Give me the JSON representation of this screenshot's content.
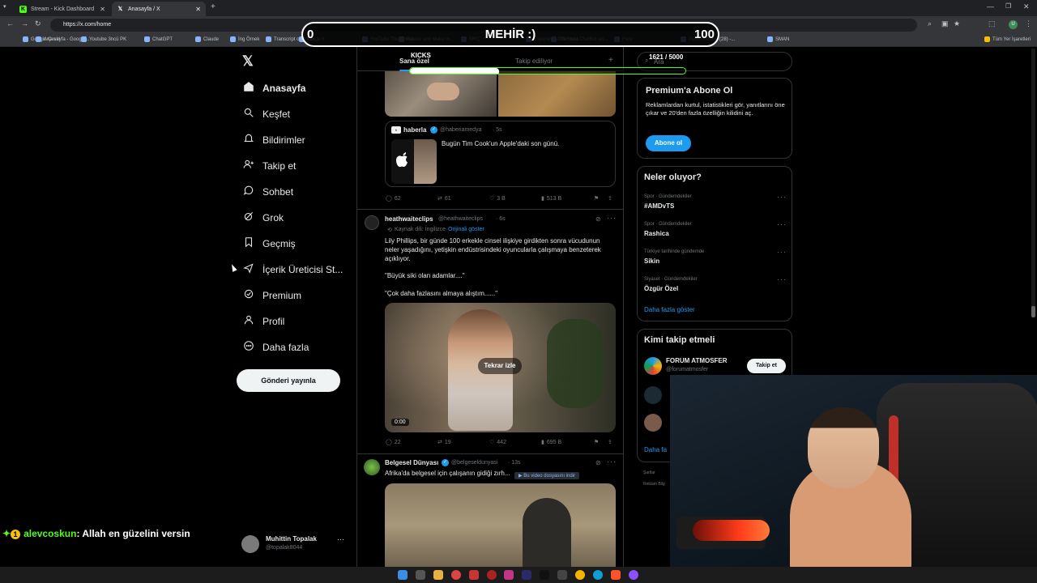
{
  "browser": {
    "tabs": [
      {
        "title": "Stream - Kick Dashboard",
        "active": false
      },
      {
        "title": "Anasayfa / X",
        "active": true
      }
    ],
    "url": "https://x.com/home",
    "bookmarks": [
      "Google Çeviri",
      "Ana sayfa - Google...",
      "Youtube 3ncü PK",
      "ChatGPT",
      "Claude",
      "İng Örnek",
      "Transcript of \"Mi M...",
      "türkçe h",
      "YouTube Thumbnail...",
      "Resize and Make In...",
      "MRÇ",
      "Esperanza000 Strea...",
      "The best ChatBot an...",
      "Flow",
      "Gelen Kutusu (28) -...",
      "SMAN"
    ],
    "bookmarks_right": "Tüm Yer İşaretleri"
  },
  "overlay": {
    "goal_title": "MEHİR :)",
    "goal_min": "0",
    "goal_max": "100",
    "kicks_label": "KICKS",
    "kicks_count": "1621 / 5000",
    "kicks_progress": 0.3242,
    "chat_user": "alevcoskun",
    "chat_msg": ": Allah en güzelini versin",
    "chat_badge": "1"
  },
  "sidebar": {
    "items": [
      {
        "label": "Anasayfa",
        "icon": "home-icon"
      },
      {
        "label": "Keşfet",
        "icon": "search-icon"
      },
      {
        "label": "Bildirimler",
        "icon": "bell-icon"
      },
      {
        "label": "Takip et",
        "icon": "follow-icon"
      },
      {
        "label": "Sohbet",
        "icon": "chat-icon"
      },
      {
        "label": "Grok",
        "icon": "grok-icon"
      },
      {
        "label": "Geçmiş",
        "icon": "bookmark-icon"
      },
      {
        "label": "İçerik Üreticisi St...",
        "icon": "creator-icon"
      },
      {
        "label": "Premium",
        "icon": "premium-icon"
      },
      {
        "label": "Profil",
        "icon": "profile-icon"
      },
      {
        "label": "Daha fazla",
        "icon": "more-icon"
      }
    ],
    "post_button": "Gönderi yayınla",
    "user_name": "Muhittin Topalak",
    "user_handle": "@topalak8044"
  },
  "feed": {
    "tabs": [
      "Sana özel",
      "Takip ediliyor"
    ],
    "quote": {
      "name": "haberla",
      "handle": "@haberiamedya",
      "time": "· 5s",
      "text": "Bugün Tim Cook'un Apple'daki son günü."
    },
    "tweet1_actions": {
      "replies": "62",
      "retweets": "61",
      "likes": "3 B",
      "views": "513 B"
    },
    "tweet2": {
      "name": "heathwaiteclips",
      "handle": "@heathwaiteclips",
      "time": "· 6s",
      "translation_note": "Kaynak dili: İngilizce",
      "translation_link": "Orijinali göster",
      "text": "Lily Phillips, bir günde 100 erkekle cinsel ilişkiye girdikten sonra vücudunun neler yaşadığını, yetişkin endüstrisindeki oyuncularla çalışmaya benzeterek açıklıyor.",
      "quote1": "\"Büyük siki olan adamlar....\"",
      "quote2": "\"Çok daha fazlasını almaya alıştım......\"",
      "video_overlay": "Tekrar izle",
      "video_time": "0:00",
      "replies": "22",
      "retweets": "19",
      "likes": "442",
      "views": "695 B"
    },
    "tweet3": {
      "name": "Belgesel Dünyası",
      "handle": "@belgeseldunyasi",
      "time": "· 13s",
      "text": "Afrika'da belgesel için çalışanın gidiği zırh...",
      "download_badge": "Bu video dosyasını indir"
    }
  },
  "right": {
    "search_placeholder": "Ara",
    "premium": {
      "title": "Premium'a Abone Ol",
      "text": "Reklamlardan kurtul, istatistikleri gör, yanıtlarını öne çıkar ve 20'den fazla özelliğin kilidini aç.",
      "button": "Abone ol"
    },
    "trends_title": "Neler oluyor?",
    "trends": [
      {
        "sub": "Spor · Gündemdekiler",
        "name": "#AMDvTS"
      },
      {
        "sub": "Spor · Gündemdekiler",
        "name": "Rashica"
      },
      {
        "sub": "Türkiye tarihinde gündemde",
        "name": "Sikin"
      },
      {
        "sub": "Siyaset · Gündemdekiler",
        "name": "Özgür Özel"
      }
    ],
    "trends_more": "Daha fazla göster",
    "who_title": "Kimi takip etmeli",
    "who": [
      {
        "name": "FORUM ATMOSFER",
        "handle": "@forumatmosfer",
        "button": "Takip et"
      }
    ],
    "who_more": "Daha fa",
    "footer1": "Şartlar",
    "footer2": "Reklam Bilg"
  },
  "colors": {
    "accent": "#1d9bf0",
    "kick_green": "#53fc18",
    "bg": "#000000",
    "border": "#2f3336"
  }
}
